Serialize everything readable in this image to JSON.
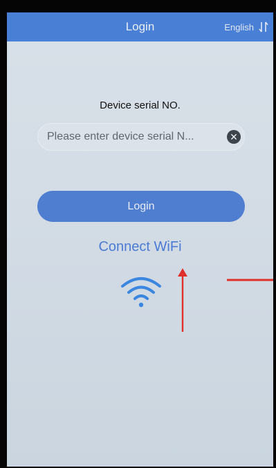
{
  "header": {
    "title": "Login",
    "language_label": "English",
    "language_icon": "sort-arrows-icon"
  },
  "form": {
    "serial_label": "Device serial NO.",
    "serial_placeholder": "Please enter device serial N...",
    "serial_value": "",
    "clear_icon": "clear-icon"
  },
  "actions": {
    "login_label": "Login",
    "connect_wifi_label": "Connect WiFi",
    "wifi_icon": "wifi-icon"
  },
  "colors": {
    "accent": "#4f7ed0",
    "link": "#4a7bd4",
    "annotation": "#e0302d"
  }
}
